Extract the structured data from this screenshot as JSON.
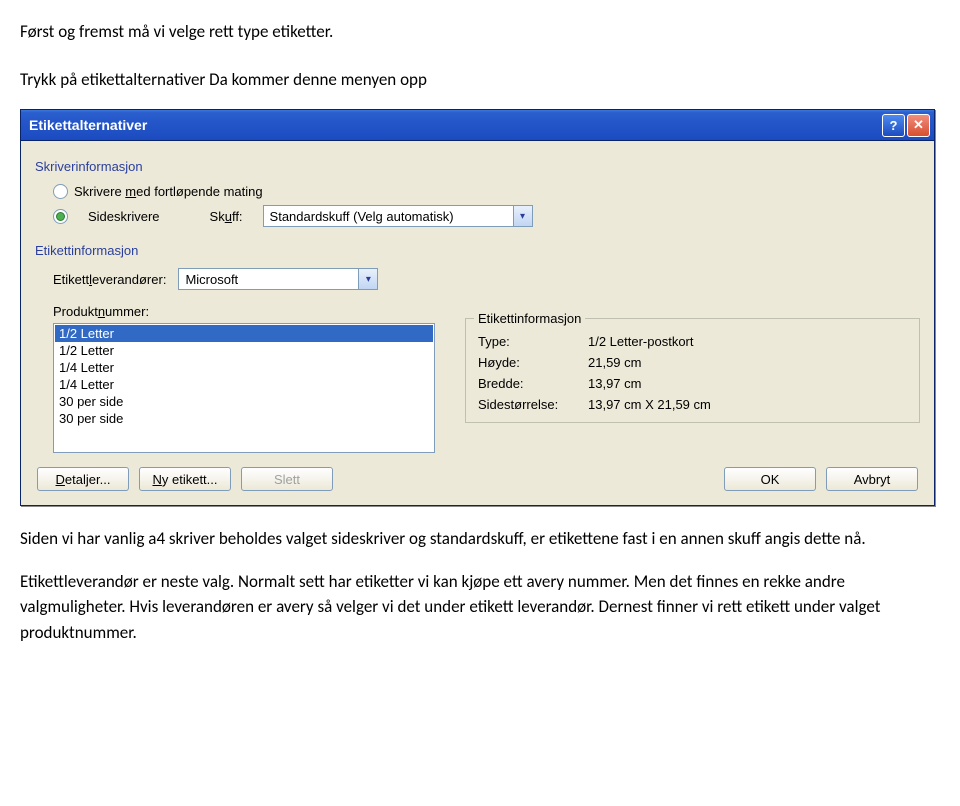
{
  "intro": {
    "line1": "Først og fremst må vi velge rett type etiketter.",
    "line2": "Trykk på etikettalternativer Da kommer denne menyen opp"
  },
  "dialog": {
    "title": "Etikettalternativer",
    "printer_section": "Skriverinformasjon",
    "radio_continuous": "Skrivere med fortløpende mating",
    "radio_page": "Sideskrivere",
    "tray_label": "Skuff:",
    "tray_value": "Standardskuff (Velg automatisk)",
    "label_section": "Etikettinformasjon",
    "vendor_label": "Etikettleverandører:",
    "vendor_value": "Microsoft",
    "product_label": "Produktnummer:",
    "list_items": [
      "1/2 Letter",
      "1/2 Letter",
      "1/4 Letter",
      "1/4 Letter",
      "30 per side",
      "30 per side"
    ],
    "info_title": "Etikettinformasjon",
    "info": {
      "type_label": "Type:",
      "type_value": "1/2 Letter-postkort",
      "height_label": "Høyde:",
      "height_value": "21,59 cm",
      "width_label": "Bredde:",
      "width_value": "13,97 cm",
      "pagesize_label": "Sidestørrelse:",
      "pagesize_value": "13,97 cm X 21,59 cm"
    },
    "buttons": {
      "details": "Detaljer...",
      "new_label": "Ny etikett...",
      "delete": "Slett",
      "ok": "OK",
      "cancel": "Avbryt"
    }
  },
  "after": {
    "p1": "Siden vi har vanlig a4 skriver beholdes valget sideskriver og standardskuff, er etikettene fast i en annen skuff angis dette nå.",
    "p2": "Etikettleverandør er neste valg. Normalt sett har etiketter vi kan kjøpe ett avery nummer. Men det finnes en rekke andre valgmuligheter. Hvis leverandøren er avery så velger vi det under etikett leverandør. Dernest finner vi rett etikett under valget produktnummer."
  }
}
